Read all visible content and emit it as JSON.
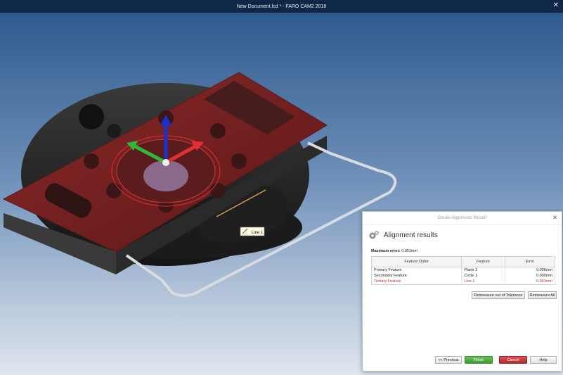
{
  "window": {
    "title": "New Document.lcd * - FARO CAM2 2018"
  },
  "viewport": {
    "feature_label": "Line 1"
  },
  "wizard": {
    "title": "Create Alignments Wizard",
    "heading": "Alignment results",
    "max_error_label": "Maximum error:",
    "max_error_value": "0.051mm",
    "columns": [
      "Feature Order",
      "Feature",
      "Error"
    ],
    "rows": [
      {
        "order": "Primary Feature",
        "feature": "Plane 1",
        "error": "0.000mm",
        "out_of_tolerance": false
      },
      {
        "order": "Secondary Feature",
        "feature": "Circle 1",
        "error": "0.000mm",
        "out_of_tolerance": false
      },
      {
        "order": "Tertiary Feature",
        "feature": "Line 1",
        "error": "0.051mm",
        "out_of_tolerance": true
      }
    ],
    "buttons": {
      "remeasure_out": "Remeasure out of Tolerance",
      "remeasure_all": "Remeasure All",
      "previous": "<< Previous",
      "finish": "Finish",
      "cancel": "Cancel",
      "help": "Help"
    }
  },
  "colors": {
    "out_of_tolerance": "#c22d2d",
    "finish": "#4aa53c",
    "cancel": "#c23a3a"
  }
}
